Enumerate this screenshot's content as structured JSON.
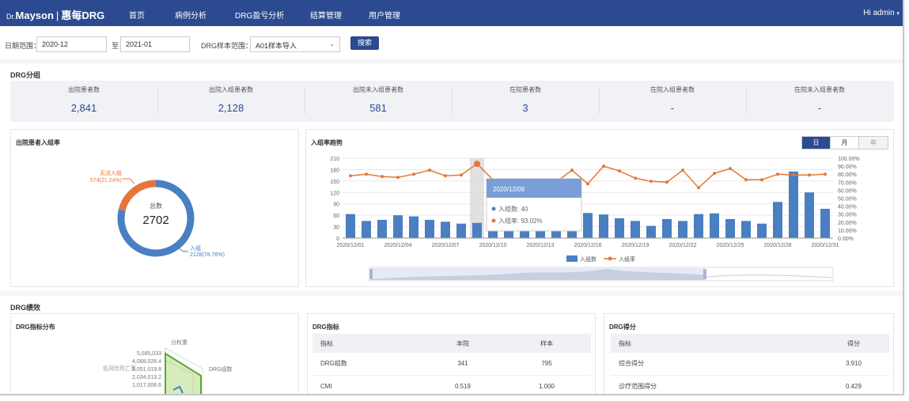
{
  "nav": {
    "logo_dr": "Dr.",
    "logo_brand": "Mayson",
    "logo_product": "惠每DRG",
    "items": [
      "首页",
      "病例分析",
      "DRG盈亏分析",
      "结算管理",
      "用户管理"
    ],
    "user": "Hi  admin"
  },
  "filters": {
    "date_label": "日期范围：",
    "date_from": "2020-12",
    "to_label": "至",
    "date_to": "2021-01",
    "sample_label": "DRG样本范围：",
    "sample_value": "A01样本导入",
    "search_label": "搜索"
  },
  "drg_group": {
    "title": "DRG分组",
    "stats": [
      {
        "label": "出院患者数",
        "value": "2,841"
      },
      {
        "label": "出院入组患者数",
        "value": "2,128"
      },
      {
        "label": "出院未入组患者数",
        "value": "581"
      },
      {
        "label": "在院患者数",
        "value": "3"
      },
      {
        "label": "在院入组患者数",
        "value": "-"
      },
      {
        "label": "在院未入组患者数",
        "value": "-"
      }
    ]
  },
  "donut": {
    "title": "出院患者入组率",
    "center_label": "总数",
    "center_value": "2702",
    "slices": [
      {
        "name": "入组",
        "value": 2128,
        "label": "2128(78.76%)",
        "color": "#4a7fc1"
      },
      {
        "name": "无法入组",
        "value": 574,
        "label": "574(21.24%)",
        "color": "#e4763c"
      }
    ]
  },
  "trend": {
    "title": "入组率趋势",
    "tabs": [
      "日",
      "月",
      "年"
    ],
    "active_tab": "日",
    "legend_count": "入组数",
    "legend_rate": "入组率",
    "tooltip": {
      "date": "2020/12/09",
      "count_line": "入组数: 40",
      "rate_line": "入组率: 93.02%"
    }
  },
  "chart_data": {
    "type": "bar",
    "title": "入组率趋势",
    "x": [
      "2020/12/01",
      "2020/12/02",
      "2020/12/03",
      "2020/12/04",
      "2020/12/05",
      "2020/12/06",
      "2020/12/07",
      "2020/12/08",
      "2020/12/09",
      "2020/12/10",
      "2020/12/11",
      "2020/12/12",
      "2020/12/13",
      "2020/12/14",
      "2020/12/15",
      "2020/12/16",
      "2020/12/17",
      "2020/12/18",
      "2020/12/19",
      "2020/12/20",
      "2020/12/21",
      "2020/12/22",
      "2020/12/23",
      "2020/12/24",
      "2020/12/25",
      "2020/12/26",
      "2020/12/27",
      "2020/12/28",
      "2020/12/29",
      "2020/12/30",
      "2020/12/31"
    ],
    "x_tick_labels": [
      "2020/12/01",
      "2020/12/04",
      "2020/12/07",
      "2020/12/10",
      "2020/12/13",
      "2020/12/16",
      "2020/12/19",
      "2020/12/22",
      "2020/12/25",
      "2020/12/28",
      "2020/12/31"
    ],
    "series": [
      {
        "name": "入组数",
        "type": "bar",
        "axis": "left",
        "color": "#4a7fc1",
        "values": [
          63,
          45,
          48,
          60,
          57,
          48,
          43,
          38,
          40,
          18,
          18,
          18,
          18,
          18,
          18,
          66,
          62,
          52,
          45,
          32,
          50,
          45,
          63,
          65,
          50,
          45,
          38,
          95,
          175,
          120,
          77
        ]
      },
      {
        "name": "入组率",
        "type": "line",
        "axis": "right",
        "color": "#e4763c",
        "values": [
          78,
          80,
          77,
          76,
          80,
          85,
          78,
          79,
          93,
          73,
          61,
          63,
          60,
          70,
          85,
          68,
          90,
          84,
          75,
          71,
          70,
          85,
          63,
          81,
          87,
          73,
          73,
          80,
          79,
          79,
          80
        ]
      }
    ],
    "y_left": {
      "range": [
        0,
        210
      ],
      "ticks": [
        0,
        30,
        60,
        90,
        120,
        150,
        180,
        210
      ]
    },
    "y_right": {
      "range": [
        0,
        100
      ],
      "ticks": [
        "0.00%",
        "10.00%",
        "20.00%",
        "30.00%",
        "40.00%",
        "50.00%",
        "60.00%",
        "70.00%",
        "80.00%",
        "90.00%",
        "100.00%"
      ]
    },
    "grid": true,
    "legend": "bottom"
  },
  "drg_perf": {
    "title": "DRG绩效",
    "radar_title": "DRG指标分布",
    "radar_axis_labels": [
      "分权重",
      "DRG组数",
      "低风险死亡率"
    ],
    "radar_ticks": [
      "5,085,033",
      "4,068,026.4",
      "3,051,019.8",
      "2,034,013.2",
      "1,017,006.6"
    ],
    "indicators": {
      "title": "DRG指标",
      "headers": [
        "指标",
        "本院",
        "样本"
      ],
      "rows": [
        [
          "DRG组数",
          "341",
          "795"
        ],
        [
          "CMI",
          "0.519",
          "1.000"
        ]
      ]
    },
    "scores": {
      "title": "DRG得分",
      "headers": [
        "指标",
        "得分"
      ],
      "rows": [
        [
          "综合得分",
          "3.910"
        ],
        [
          "诊疗范围得分",
          "0.429"
        ]
      ]
    }
  }
}
